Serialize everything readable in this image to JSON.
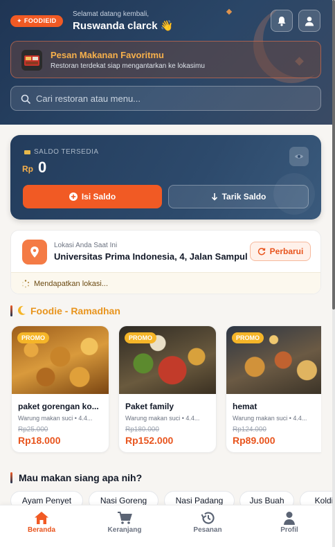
{
  "header": {
    "brand": "FOODIEID",
    "greeting_small": "Selamat datang kembali,",
    "user_name": "Ruswanda clarck 👋",
    "promo_title": "Pesan Makanan Favoritmu",
    "promo_subtitle": "Restoran terdekat siap mengantarkan ke lokasimu",
    "search_placeholder": "Cari restoran atau menu..."
  },
  "balance": {
    "label": "SALDO TERSEDIA",
    "currency": "Rp",
    "amount": "0",
    "topup_label": "Isi Saldo",
    "withdraw_label": "Tarik Saldo"
  },
  "location": {
    "caption": "Lokasi Anda Saat Ini",
    "address": "Universitas Prima Indonesia, 4, Jalan Sampul",
    "refresh_label": "Perbarui",
    "status": "Mendapatkan lokasi..."
  },
  "section_ramadhan": {
    "title": "Foodie - Ramadhan",
    "items": [
      {
        "badge": "PROMO",
        "name": "paket gorengan ko...",
        "shop": "Warung makan suci • 4.4...",
        "old_price": "Rp25.000",
        "price": "Rp18.000"
      },
      {
        "badge": "PROMO",
        "name": "Paket family",
        "shop": "Warung makan suci • 4.4...",
        "old_price": "Rp180.000",
        "price": "Rp152.000"
      },
      {
        "badge": "PROMO",
        "name": "hemat",
        "shop": "Warung makan suci • 4.4...",
        "old_price": "Rp124.000",
        "price": "Rp89.000"
      }
    ]
  },
  "section_lunch": {
    "title": "Mau makan siang apa nih?",
    "categories": [
      "Ayam Penyet",
      "Nasi Goreng",
      "Nasi Padang",
      "Jus Buah",
      "Koldi"
    ]
  },
  "nav": {
    "items": [
      "Beranda",
      "Keranjang",
      "Pesanan",
      "Profil"
    ],
    "active": "Beranda"
  },
  "colors": {
    "accent": "#f15a24",
    "header_bg": "#1f3554",
    "gold": "#f7b04b"
  }
}
